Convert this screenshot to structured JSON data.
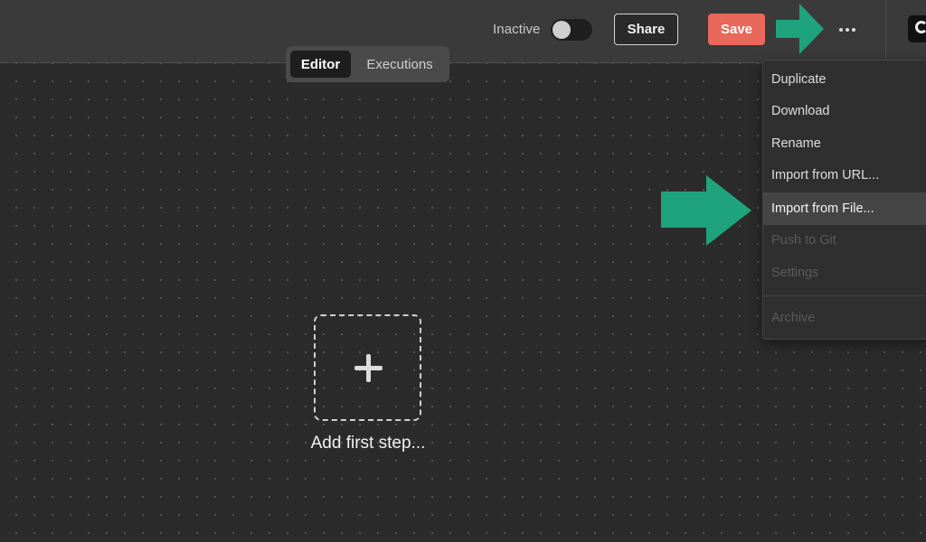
{
  "header": {
    "toggle_label": "Inactive",
    "toggle_state": "off",
    "share_label": "Share",
    "save_label": "Save",
    "more_icon": "ellipsis-icon",
    "logo_icon": "logo-icon"
  },
  "tabs": [
    {
      "label": "Editor",
      "active": true
    },
    {
      "label": "Executions",
      "active": false
    }
  ],
  "menu": {
    "items": [
      {
        "label": "Duplicate",
        "state": "enabled"
      },
      {
        "label": "Download",
        "state": "enabled"
      },
      {
        "label": "Rename",
        "state": "enabled"
      },
      {
        "label": "Import from URL...",
        "state": "enabled"
      },
      {
        "label": "Import from File...",
        "state": "highlighted"
      },
      {
        "label": "Push to Git",
        "state": "disabled"
      },
      {
        "label": "Settings",
        "state": "disabled"
      },
      {
        "label": "Archive",
        "state": "disabled"
      }
    ]
  },
  "canvas": {
    "add_step_label": "Add first step...",
    "add_icon": "plus-icon"
  },
  "colors": {
    "save_accent": "#e8685b",
    "annotation_arrow": "#1fa37c",
    "background": "#2b2b2b"
  }
}
